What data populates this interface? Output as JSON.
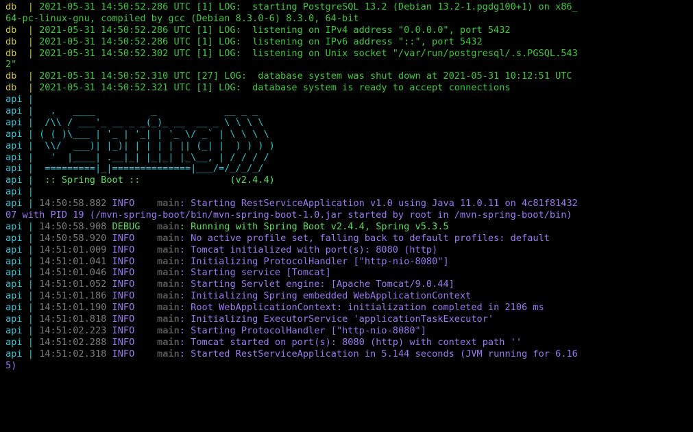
{
  "colors": {
    "background": "#000000",
    "db_service": "#c9c533",
    "api_service": "#2cc6d6",
    "db_log_text": "#3ec93c",
    "info_text": "#9a78f2",
    "debug_text": "#55e05a",
    "timestamp": "#7c7c7c",
    "thread": "#555555"
  },
  "lines": [
    {
      "kind": "db",
      "service": "db",
      "sep": "  | ",
      "text": "2021-05-31 14:50:52.286 UTC [1] LOG:  starting PostgreSQL 13.2 (Debian 13.2-1.pgdg100+1) on x86_"
    },
    {
      "kind": "wrap-db",
      "text": "64-pc-linux-gnu, compiled by gcc (Debian 8.3.0-6) 8.3.0, 64-bit"
    },
    {
      "kind": "db",
      "service": "db",
      "sep": "  | ",
      "text": "2021-05-31 14:50:52.286 UTC [1] LOG:  listening on IPv4 address \"0.0.0.0\", port 5432"
    },
    {
      "kind": "db",
      "service": "db",
      "sep": "  | ",
      "text": "2021-05-31 14:50:52.286 UTC [1] LOG:  listening on IPv6 address \"::\", port 5432"
    },
    {
      "kind": "db",
      "service": "db",
      "sep": "  | ",
      "text": "2021-05-31 14:50:52.302 UTC [1] LOG:  listening on Unix socket \"/var/run/postgresql/.s.PGSQL.543"
    },
    {
      "kind": "wrap-db",
      "text": "2\""
    },
    {
      "kind": "db",
      "service": "db",
      "sep": "  | ",
      "text": "2021-05-31 14:50:52.310 UTC [27] LOG:  database system was shut down at 2021-05-31 10:12:51 UTC"
    },
    {
      "kind": "db",
      "service": "db",
      "sep": "  | ",
      "text": "2021-05-31 14:50:52.321 UTC [1] LOG:  database system is ready to accept connections"
    },
    {
      "kind": "banner",
      "service": "api",
      "sep": " | ",
      "text": ""
    },
    {
      "kind": "banner",
      "service": "api",
      "sep": " | ",
      "text": "  .   ____          _            __ _ _"
    },
    {
      "kind": "banner",
      "service": "api",
      "sep": " | ",
      "text": " /\\\\ / ___'_ __ _ _(_)_ __  __ _ \\ \\ \\ \\"
    },
    {
      "kind": "banner",
      "service": "api",
      "sep": " | ",
      "text": "( ( )\\___ | '_ | '_| | '_ \\/ _` | \\ \\ \\ \\"
    },
    {
      "kind": "banner",
      "service": "api",
      "sep": " | ",
      "text": " \\\\/  ___)| |_)| | | | | || (_| |  ) ) ) )"
    },
    {
      "kind": "banner",
      "service": "api",
      "sep": " | ",
      "text": "  '  |____| .__|_| |_|_| |_\\__, | / / / /"
    },
    {
      "kind": "banner",
      "service": "api",
      "sep": " | ",
      "text": " =========|_|==============|___/=/_/_/_/"
    },
    {
      "kind": "banner-label",
      "service": "api",
      "sep": " | ",
      "text": " :: Spring Boot ::                (v2.4.4)"
    },
    {
      "kind": "banner",
      "service": "api",
      "sep": " | ",
      "text": ""
    },
    {
      "kind": "log",
      "service": "api",
      "sep": " | ",
      "time": "14:50:58.882",
      "level": "INFO",
      "levelpad": "  ",
      "thread": "main",
      "msg": "Starting RestServiceApplication v1.0 using Java 11.0.11 on 4c81f81432"
    },
    {
      "kind": "wrap-info",
      "text": "07 with PID 19 (/mvn-spring-boot/bin/mvn-spring-boot-1.0.jar started by root in /mvn-spring-boot/bin)"
    },
    {
      "kind": "log",
      "service": "api",
      "sep": " | ",
      "time": "14:50:58.908",
      "level": "DEBUG",
      "levelpad": " ",
      "thread": "main",
      "msg": "Running with Spring Boot v2.4.4, Spring v5.3.5"
    },
    {
      "kind": "log",
      "service": "api",
      "sep": " | ",
      "time": "14:50:58.920",
      "level": "INFO",
      "levelpad": "  ",
      "thread": "main",
      "msg": "No active profile set, falling back to default profiles: default"
    },
    {
      "kind": "log",
      "service": "api",
      "sep": " | ",
      "time": "14:51:01.009",
      "level": "INFO",
      "levelpad": "  ",
      "thread": "main",
      "msg": "Tomcat initialized with port(s): 8080 (http)"
    },
    {
      "kind": "log",
      "service": "api",
      "sep": " | ",
      "time": "14:51:01.041",
      "level": "INFO",
      "levelpad": "  ",
      "thread": "main",
      "msg": "Initializing ProtocolHandler [\"http-nio-8080\"]"
    },
    {
      "kind": "log",
      "service": "api",
      "sep": " | ",
      "time": "14:51:01.046",
      "level": "INFO",
      "levelpad": "  ",
      "thread": "main",
      "msg": "Starting service [Tomcat]"
    },
    {
      "kind": "log",
      "service": "api",
      "sep": " | ",
      "time": "14:51:01.052",
      "level": "INFO",
      "levelpad": "  ",
      "thread": "main",
      "msg": "Starting Servlet engine: [Apache Tomcat/9.0.44]"
    },
    {
      "kind": "log",
      "service": "api",
      "sep": " | ",
      "time": "14:51:01.186",
      "level": "INFO",
      "levelpad": "  ",
      "thread": "main",
      "msg": "Initializing Spring embedded WebApplicationContext"
    },
    {
      "kind": "log",
      "service": "api",
      "sep": " | ",
      "time": "14:51:01.190",
      "level": "INFO",
      "levelpad": "  ",
      "thread": "main",
      "msg": "Root WebApplicationContext: initialization completed in 2106 ms"
    },
    {
      "kind": "log",
      "service": "api",
      "sep": " | ",
      "time": "14:51:01.818",
      "level": "INFO",
      "levelpad": "  ",
      "thread": "main",
      "msg": "Initializing ExecutorService 'applicationTaskExecutor'"
    },
    {
      "kind": "log",
      "service": "api",
      "sep": " | ",
      "time": "14:51:02.223",
      "level": "INFO",
      "levelpad": "  ",
      "thread": "main",
      "msg": "Starting ProtocolHandler [\"http-nio-8080\"]"
    },
    {
      "kind": "log",
      "service": "api",
      "sep": " | ",
      "time": "14:51:02.288",
      "level": "INFO",
      "levelpad": "  ",
      "thread": "main",
      "msg": "Tomcat started on port(s): 8080 (http) with context path ''"
    },
    {
      "kind": "log",
      "service": "api",
      "sep": " | ",
      "time": "14:51:02.318",
      "level": "INFO",
      "levelpad": "  ",
      "thread": "main",
      "msg": "Started RestServiceApplication in 5.144 seconds (JVM running for 6.16"
    },
    {
      "kind": "wrap-info",
      "text": "5)"
    }
  ]
}
